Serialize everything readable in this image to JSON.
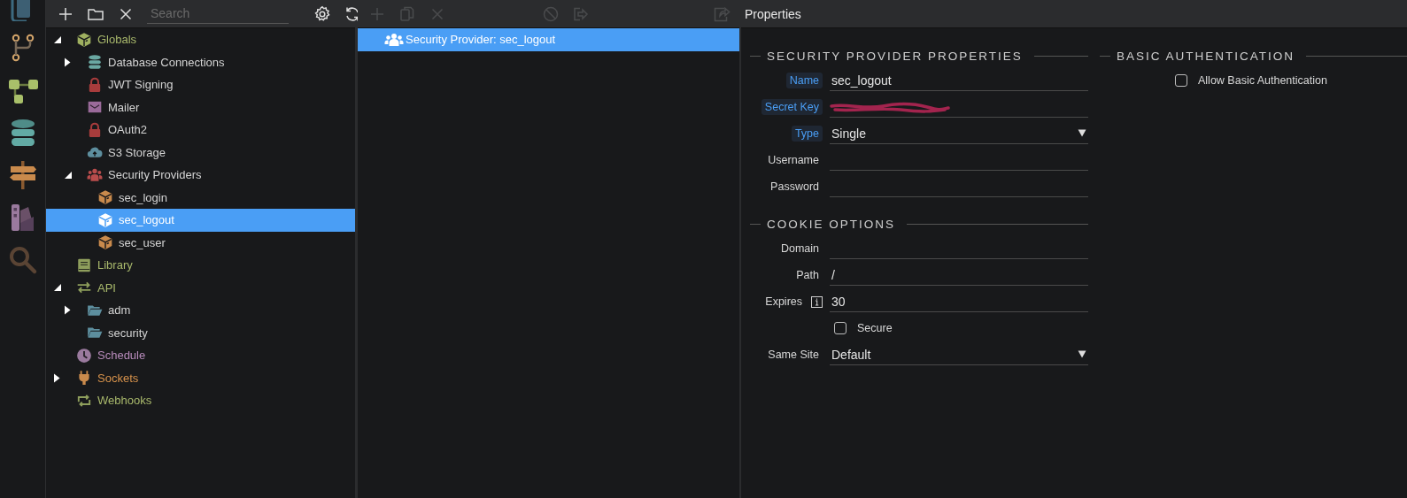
{
  "tree_toolbar": {
    "search": {
      "placeholder": "Search"
    }
  },
  "tree": [
    {
      "label": "Globals",
      "kind": "globals",
      "color": "#a9b96c",
      "expanded": true,
      "selected": false,
      "children": [
        {
          "label": "Database Connections",
          "kind": "database",
          "color": "#d4d4d4",
          "expanded": false,
          "selected": false
        },
        {
          "label": "JWT Signing",
          "kind": "lock",
          "color": "#d4d4d4",
          "selected": false
        },
        {
          "label": "Mailer",
          "kind": "mail",
          "color": "#d4d4d4",
          "selected": false
        },
        {
          "label": "OAuth2",
          "kind": "lock",
          "color": "#d4d4d4",
          "selected": false
        },
        {
          "label": "S3 Storage",
          "kind": "cloud",
          "color": "#d4d4d4",
          "selected": false
        },
        {
          "label": "Security Providers",
          "kind": "users",
          "color": "#d4d4d4",
          "expanded": true,
          "selected": false,
          "children": [
            {
              "label": "sec_login",
              "kind": "provider",
              "color": "#d4d4d4",
              "selected": false
            },
            {
              "label": "sec_logout",
              "kind": "provider",
              "color": "#ffffff",
              "selected": true
            },
            {
              "label": "sec_user",
              "kind": "provider",
              "color": "#d4d4d4",
              "selected": false
            }
          ]
        }
      ]
    },
    {
      "label": "Library",
      "kind": "library",
      "color": "#a9b96c",
      "selected": false
    },
    {
      "label": "API",
      "kind": "api",
      "color": "#a9b96c",
      "expanded": true,
      "selected": false,
      "children": [
        {
          "label": "adm",
          "kind": "folder",
          "color": "#d4d4d4",
          "expanded": false,
          "selected": false
        },
        {
          "label": "security",
          "kind": "folder",
          "color": "#d4d4d4",
          "selected": false
        }
      ]
    },
    {
      "label": "Schedule",
      "kind": "schedule",
      "color": "#b98cbd",
      "selected": false
    },
    {
      "label": "Sockets",
      "kind": "socket",
      "color": "#d8934c",
      "expanded": false,
      "selected": false
    },
    {
      "label": "Webhooks",
      "kind": "webhook",
      "color": "#a9b96c",
      "selected": false
    }
  ],
  "list": {
    "rows": [
      {
        "label": "Security Provider: sec_logout",
        "selected": true
      }
    ]
  },
  "properties": {
    "title": "Properties",
    "sections": [
      {
        "heading": "SECURITY PROVIDER PROPERTIES",
        "fields": [
          {
            "kind": "text",
            "label": "Name",
            "highlighted": true,
            "value": "sec_logout"
          },
          {
            "kind": "secret",
            "label": "Secret Key",
            "highlighted": true
          },
          {
            "kind": "select",
            "label": "Type",
            "highlighted": true,
            "value": "Single"
          },
          {
            "kind": "text",
            "label": "Username",
            "highlighted": false
          },
          {
            "kind": "text",
            "label": "Password",
            "highlighted": false
          }
        ]
      },
      {
        "heading": "COOKIE OPTIONS",
        "fields": [
          {
            "kind": "text",
            "label": "Domain",
            "highlighted": false
          },
          {
            "kind": "text",
            "label": "Path",
            "highlighted": false,
            "value": "/"
          },
          {
            "kind": "text",
            "label": "Expires",
            "highlighted": false,
            "info": true,
            "value": "30"
          },
          {
            "kind": "checkbox",
            "label": "Secure",
            "checked": false
          },
          {
            "kind": "select",
            "label": "Same Site",
            "highlighted": false,
            "value": "Default"
          }
        ]
      }
    ],
    "side_sections": [
      {
        "heading": "BASIC AUTHENTICATION",
        "fields": [
          {
            "kind": "checkbox",
            "label": "Allow Basic Authentication",
            "checked": false
          }
        ]
      }
    ]
  }
}
